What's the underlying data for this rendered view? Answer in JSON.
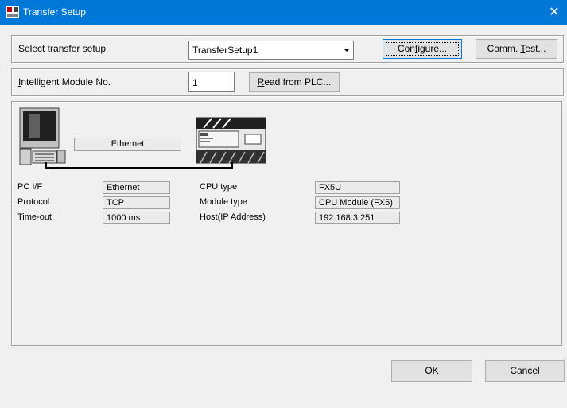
{
  "window": {
    "title": "Transfer Setup",
    "close_glyph": "✕"
  },
  "select_row": {
    "label": "Select transfer setup",
    "combo_value": "TransferSetup1",
    "configure_label_pre": "Con",
    "configure_label_ul": "f",
    "configure_label_post": "igure...",
    "commtest_label_pre": "Comm. ",
    "commtest_label_ul": "T",
    "commtest_label_post": "est..."
  },
  "module_row": {
    "label_ul": "I",
    "label_post": "ntelligent Module No.",
    "value": "1",
    "read_label_ul": "R",
    "read_label_post": "ead from PLC..."
  },
  "diagram": {
    "connection_label": "Ethernet"
  },
  "info": {
    "left": [
      {
        "label": "PC I/F",
        "value": "Ethernet"
      },
      {
        "label": "Protocol",
        "value": "TCP"
      },
      {
        "label": "Time-out",
        "value": "1000 ms"
      }
    ],
    "right": [
      {
        "label": "CPU type",
        "value": "FX5U"
      },
      {
        "label": "Module type",
        "value": "CPU Module (FX5)"
      },
      {
        "label": "Host(IP Address)",
        "value": "192.168.3.251"
      }
    ]
  },
  "footer": {
    "ok_label": "OK",
    "cancel_label": "Cancel"
  }
}
